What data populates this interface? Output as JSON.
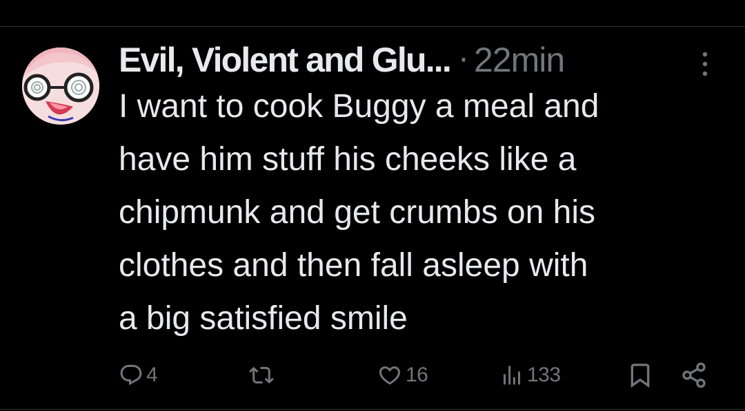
{
  "tweet": {
    "display_name": "Evil, Violent and Glu...",
    "separator": "·",
    "time": "22min",
    "text": "I want to cook Buggy a meal and\nhave him stuff his cheeks like a\nchipmunk and get crumbs on his\nclothes and then fall asleep with\na big satisfied smile"
  },
  "actions": {
    "reply_count": "4",
    "retweet_count": "",
    "like_count": "16",
    "views_count": "133"
  },
  "colors": {
    "background": "#000000",
    "primary_text": "#e7e9ea",
    "secondary_text": "#71767b",
    "divider": "#2f3336"
  },
  "icons": {
    "reply": "reply-icon",
    "retweet": "retweet-icon",
    "like": "heart-icon",
    "views": "views-icon",
    "bookmark": "bookmark-icon",
    "share": "share-icon",
    "more": "more-vertical-icon"
  }
}
